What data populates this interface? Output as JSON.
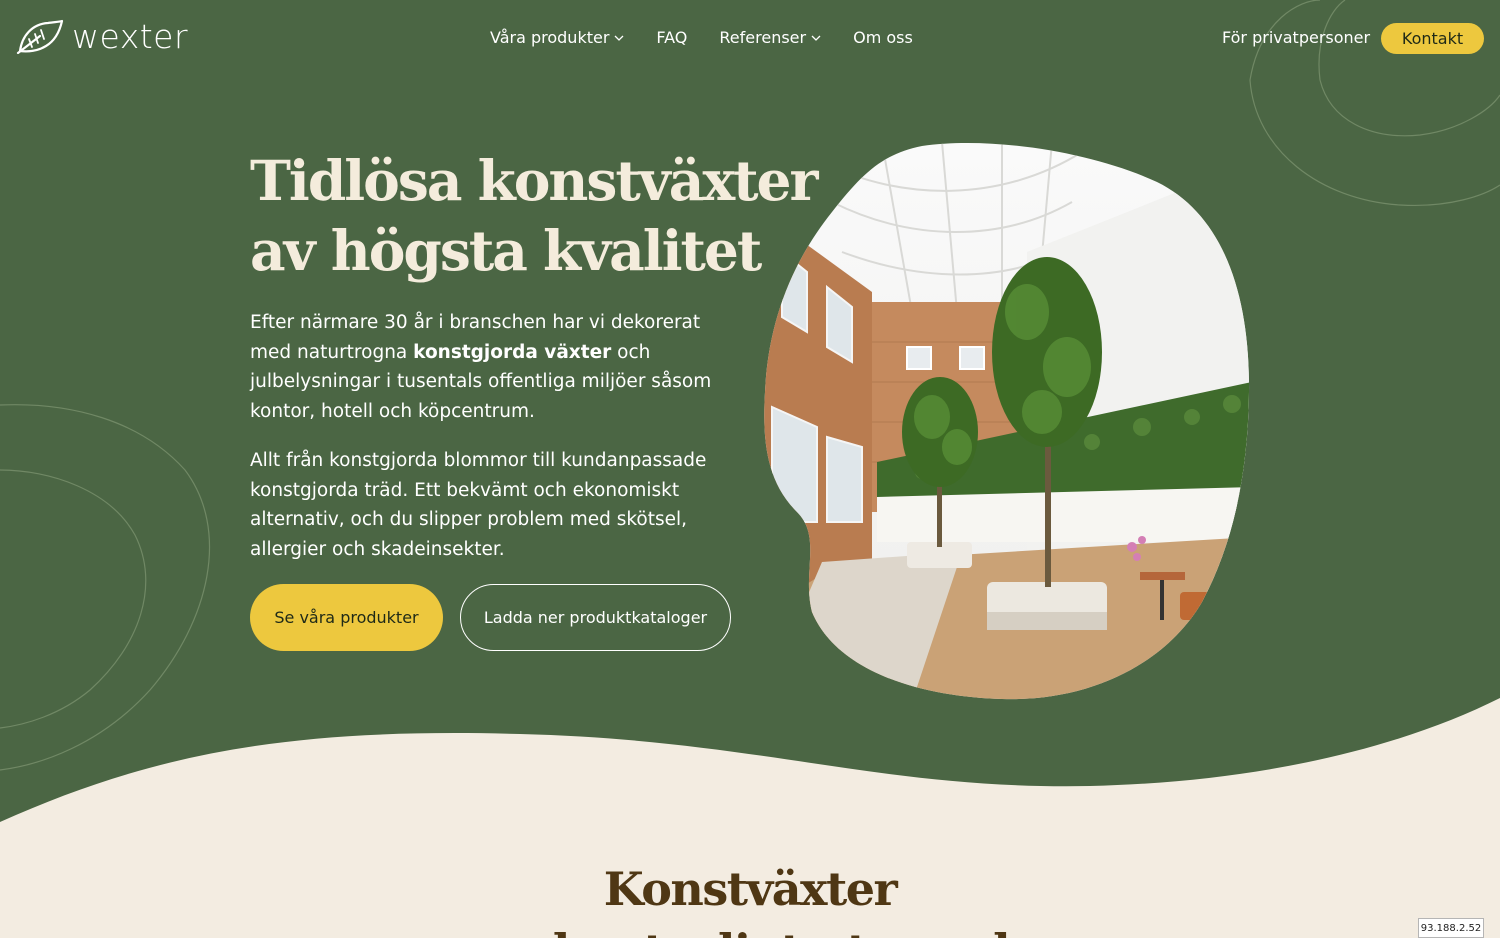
{
  "brand": {
    "name": "wexter"
  },
  "nav": {
    "items": [
      {
        "label": "Våra produkter",
        "dropdown": true
      },
      {
        "label": "FAQ",
        "dropdown": false
      },
      {
        "label": "Referenser",
        "dropdown": true
      },
      {
        "label": "Om oss",
        "dropdown": false
      }
    ],
    "private_link": "För privatpersoner",
    "contact_button": "Kontakt"
  },
  "hero": {
    "title_line1": "Tidlösa konstväxter",
    "title_line2": "av högsta kvalitet",
    "para1_before": "Efter närmare 30 år i branschen har vi dekorerat med naturtrogna ",
    "para1_bold": "konstgjorda växter",
    "para1_after": " och julbelysningar i tusentals offentliga miljöer såsom kontor, hotell och köpcentrum.",
    "para2": "Allt från konstgjorda blommor till kundanpassade konstgjorda träd. Ett bekvämt och ekonomiskt alternativ, och du slipper problem med skötsel, allergier och skadeinsekter.",
    "primary_button": "Se våra produkter",
    "secondary_button": "Ladda ner produktkataloger"
  },
  "section": {
    "title_line1": "Konstväxter",
    "title_line2": "med naturligt utseende"
  },
  "badge": {
    "ip": "93.188.2.52"
  },
  "colors": {
    "hero_green": "#4b6644",
    "cream": "#f3ece1",
    "accent_yellow": "#edc83e",
    "section_brown": "#4f3714"
  }
}
